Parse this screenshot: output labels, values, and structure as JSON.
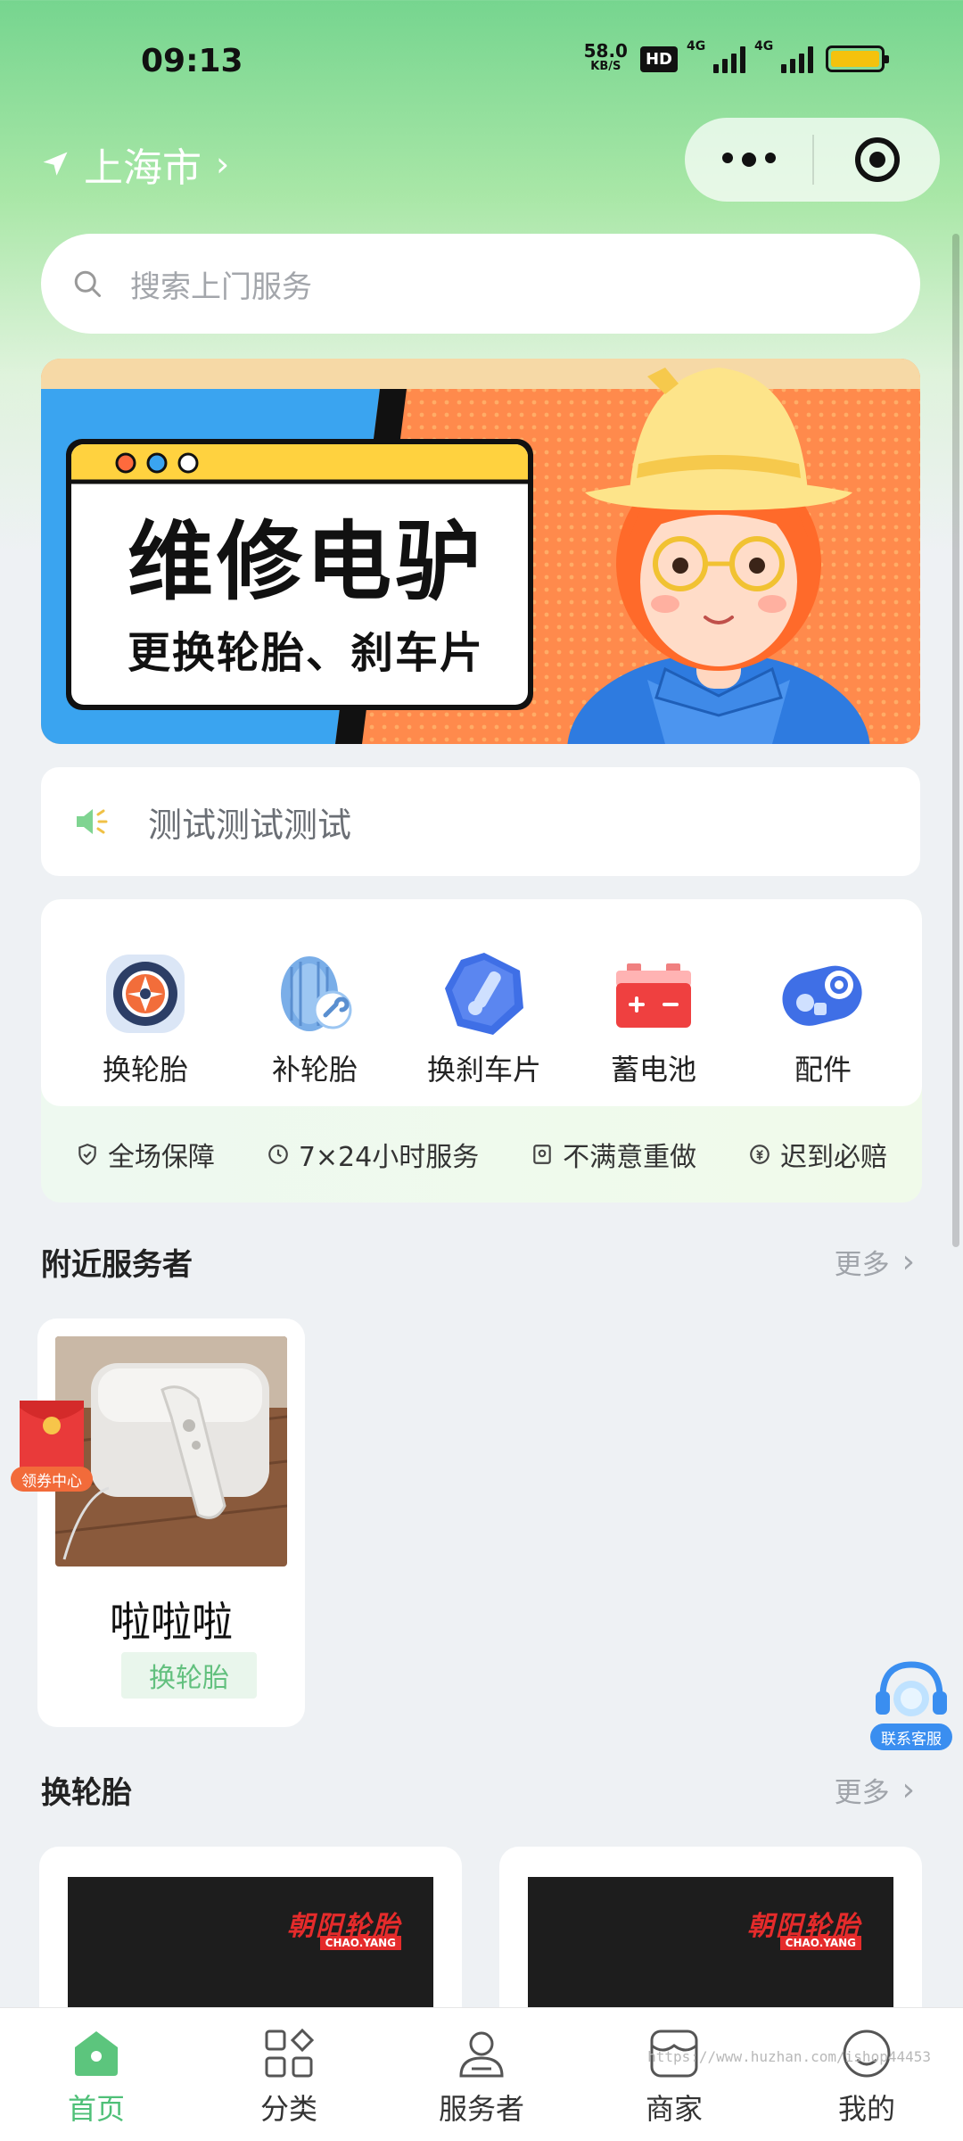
{
  "status_bar": {
    "time": "09:13",
    "net_speed": "58.0",
    "net_unit": "KB/S",
    "hd": "HD",
    "sig1_label": "4G",
    "sig2_label": "4G"
  },
  "header": {
    "location": "上海市"
  },
  "search": {
    "placeholder": "搜索上门服务"
  },
  "banner": {
    "title": "维修电驴",
    "subtitle": "更换轮胎、刹车片"
  },
  "notice": {
    "text": "测试测试测试"
  },
  "categories": [
    {
      "label": "换轮胎",
      "icon": "tire-icon"
    },
    {
      "label": "补轮胎",
      "icon": "tire-repair-icon"
    },
    {
      "label": "换刹车片",
      "icon": "brake-pad-icon"
    },
    {
      "label": "蓄电池",
      "icon": "battery-icon"
    },
    {
      "label": "配件",
      "icon": "parts-icon"
    }
  ],
  "guarantees": [
    {
      "label": "全场保障",
      "icon": "shield-icon"
    },
    {
      "label": "7×24小时服务",
      "icon": "clock-icon"
    },
    {
      "label": "不满意重做",
      "icon": "redo-icon"
    },
    {
      "label": "迟到必赔",
      "icon": "compensation-icon"
    }
  ],
  "nearby": {
    "title": "附近服务者",
    "more": "更多",
    "provider": {
      "name": "啦啦啦",
      "tag": "换轮胎"
    }
  },
  "coupon": {
    "label": "领券中心"
  },
  "customer_service": {
    "label": "联系客服"
  },
  "tire_section": {
    "title": "换轮胎",
    "more": "更多",
    "products": [
      {
        "brand": "朝阳轮胎",
        "brand_en": "CHAO.YANG"
      },
      {
        "brand": "朝阳轮胎",
        "brand_en": "CHAO.YANG"
      }
    ]
  },
  "tabbar": {
    "tabs": [
      {
        "label": "首页",
        "active": true
      },
      {
        "label": "分类",
        "active": false
      },
      {
        "label": "服务者",
        "active": false
      },
      {
        "label": "商家",
        "active": false
      },
      {
        "label": "我的",
        "active": false
      }
    ]
  },
  "watermark": "https://www.huzhan.com/ishop44453",
  "colors": {
    "brand_green": "#4fc078",
    "tag_green": "#62c07e",
    "banner_orange": "#ff8a4c",
    "banner_blue": "#3aa4f0",
    "accent_red": "#e52b2b"
  }
}
